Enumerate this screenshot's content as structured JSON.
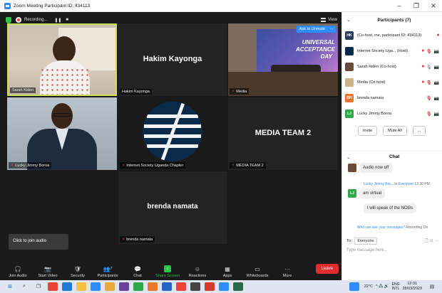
{
  "window": {
    "title": "Zoom Meeting Participant ID: 434113",
    "minimize": "–",
    "maximize": "❐",
    "close": "✕"
  },
  "topbar": {
    "recording": "Recording...",
    "pause": "❚❚",
    "stop": "■",
    "view": "View"
  },
  "tiles": [
    {
      "name": "Sarah Kiden",
      "muted": false,
      "active_speaker": true
    },
    {
      "name": "Hakim Kayonga",
      "big_label": "Hakim Kayonga",
      "muted": false
    },
    {
      "name": "Media",
      "muted": true,
      "ask_to_unmute": "Ask to Unmute",
      "more": "···"
    },
    {
      "name": "Lucky Jimmy Boroa",
      "muted": true
    },
    {
      "name": "Internet Society Uganda Chapter",
      "muted": true
    },
    {
      "name": "MEDIA TEAM 2",
      "big_label": "MEDIA TEAM 2",
      "muted": true
    },
    {
      "name": "brenda namata",
      "big_label": "brenda namata",
      "muted": true
    }
  ],
  "media_banner": {
    "line1": "UNIVERSAL",
    "line2": "ACCEPTANCE",
    "line3": "DAY"
  },
  "tooltip": "Click to join audio",
  "toolbar": {
    "items": [
      {
        "label": "Join Audio",
        "icon": "headphones-icon",
        "glyph": "🎧"
      },
      {
        "label": "Start Video",
        "icon": "video-off-icon",
        "glyph": "📷"
      },
      {
        "label": "Security",
        "icon": "shield-icon",
        "glyph": "🛡"
      },
      {
        "label": "Participants",
        "icon": "participants-icon",
        "glyph": "👥",
        "count": "7"
      },
      {
        "label": "Chat",
        "icon": "chat-icon",
        "glyph": "💬"
      },
      {
        "label": "Share Screen",
        "icon": "share-screen-icon",
        "glyph": "↑"
      },
      {
        "label": "Reactions",
        "icon": "reactions-icon",
        "glyph": "☺"
      },
      {
        "label": "Apps",
        "icon": "apps-icon",
        "glyph": "▦"
      },
      {
        "label": "Whiteboards",
        "icon": "whiteboard-icon",
        "glyph": "▭"
      },
      {
        "label": "More",
        "icon": "more-icon",
        "glyph": "···"
      }
    ],
    "leave": "Leave"
  },
  "participants_panel": {
    "title": "Participants (7)",
    "chevron": "⌄",
    "rows": [
      {
        "initials": "HK",
        "avatar_color": "#2a3a5a",
        "label": "(Co-host, me, participant ID: 434113)",
        "icons": [
          "⏺"
        ]
      },
      {
        "initials": "",
        "avatar_color": "#0a2a4a",
        "label": "Internet Society Uga... (Host)",
        "icons": [
          "⏺",
          "🎙",
          "📷"
        ]
      },
      {
        "initials": "",
        "avatar_color": "#6a4a3a",
        "label": "Sarah Kiden (Co-host)",
        "icons": [
          "⏺",
          "🎙",
          "📷"
        ]
      },
      {
        "initials": "",
        "avatar_color": "#c9b18a",
        "label": "Media (Co-host)",
        "icons": [
          "⏺",
          "🎙",
          "📷"
        ]
      },
      {
        "initials": "BN",
        "avatar_color": "#e8762d",
        "label": "brenda namata",
        "icons": [
          "🎙",
          "📷"
        ]
      },
      {
        "initials": "LJ",
        "avatar_color": "#2ea84a",
        "label": "Lucky Jimmy Boroa",
        "icons": [
          "🎙",
          "📷"
        ]
      }
    ],
    "invite": "Invite",
    "mute_all": "Mute All",
    "more": "..."
  },
  "chat": {
    "title": "Chat",
    "messages": [
      {
        "text": "Audio now off"
      },
      {
        "sender": "Lucky Jimmy Bor...",
        "to_word": "to",
        "recipient": "Everyone",
        "time": "12:30 PM",
        "text": "am virtual"
      },
      {
        "text": "I will speak of the NOGs"
      }
    ],
    "privacy": "Who can see your messages?",
    "recording": "Recording On",
    "to_label": "To:",
    "to_value": "Everyone",
    "placeholder": "Type message here..."
  },
  "taskbar": {
    "weather": "22°C",
    "lang": "ENG",
    "lang_sub": "INTL",
    "time": "12:31",
    "date": "28/03/2023"
  }
}
